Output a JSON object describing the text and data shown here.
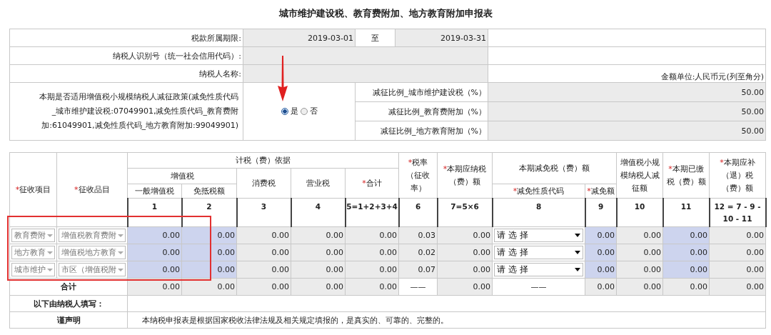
{
  "title": "城市维护建设税、教育费附加、地方教育附加申报表",
  "period": {
    "label": "税款所属期限:",
    "start": "2019-03-01",
    "to": "至",
    "end": "2019-03-31"
  },
  "taxpayer_id": {
    "label": "纳税人识别号（统一社会信用代码）:"
  },
  "taxpayer_name": {
    "label": "纳税人名称:"
  },
  "unit": "金额单位:人民币元(列至角分)",
  "policy": {
    "label": "本期是否适用增值税小规模纳税人减征政策(减免性质代码_城市维护建设税:07049901,减免性质代码_教育费附加:61049901,减免性质代码_地方教育附加:99049901)",
    "options": [
      {
        "label": "是",
        "selected": true
      },
      {
        "label": "否",
        "selected": false
      }
    ],
    "ratios": [
      {
        "label": "减征比例_城市维护建设税（%）",
        "value": "50.00"
      },
      {
        "label": "减征比例_教育费附加（%）",
        "value": "50.00"
      },
      {
        "label": "减征比例_地方教育附加（%）",
        "value": "50.00"
      }
    ]
  },
  "header": {
    "item": {
      "mark": "*",
      "label": "征收项目"
    },
    "category": {
      "mark": "*",
      "label": "征收品目"
    },
    "basis": "计税（费）依据",
    "vat": "增值税",
    "vat_general": "一般增值税",
    "vat_exempt": "免抵税额",
    "consumption": "消费税",
    "business": "营业税",
    "total": {
      "mark": "*",
      "label": "合计"
    },
    "rate": {
      "mark": "*",
      "label": "税率（征收率）"
    },
    "payable": {
      "mark": "*",
      "label": "本期应纳税（费）额"
    },
    "relief": "本期减免税（费）额",
    "relief_code": {
      "mark": "*",
      "label": "减免性质代码"
    },
    "relief_amount": {
      "mark": "*",
      "label": "减免额"
    },
    "small_scale": "增值税小规模纳税人减征额",
    "paid": {
      "mark": "*",
      "label": "本期已缴税（费）额"
    },
    "due": {
      "mark": "*",
      "label": "本期应补（退）税（费）额"
    }
  },
  "columns": [
    {
      "number": "1",
      "kind": "input"
    },
    {
      "number": "2",
      "kind": "input"
    },
    {
      "number": "3",
      "kind": "calc"
    },
    {
      "number": "4",
      "kind": "calc"
    },
    {
      "number": "5=1+2+3+4",
      "kind": "calc"
    },
    {
      "number": "6",
      "kind": "calc"
    },
    {
      "number": "7=5×6",
      "kind": "calc"
    },
    {
      "number": "8",
      "kind": "select"
    },
    {
      "number": "9",
      "kind": "input"
    },
    {
      "number": "10",
      "kind": "calc"
    },
    {
      "number": "11",
      "kind": "input"
    },
    {
      "number": "12 = 7 - 9 - 10 - 11",
      "kind": "calc"
    }
  ],
  "rows": [
    {
      "item": "教育费附",
      "category": "增值税教育费附",
      "cells": [
        "0.00",
        "0.00",
        "0.00",
        "0.00",
        "0.00",
        "0.03",
        "0.00",
        "请 选 择",
        "0.00",
        "0.00",
        "0.00",
        "0.00"
      ]
    },
    {
      "item": "地方教育",
      "category": "增值税地方教育",
      "cells": [
        "0.00",
        "0.00",
        "0.00",
        "0.00",
        "0.00",
        "0.02",
        "0.00",
        "请 选 择",
        "0.00",
        "0.00",
        "0.00",
        "0.00"
      ]
    },
    {
      "item": "城市维护",
      "category": "市区（增值税附",
      "cells": [
        "0.00",
        "0.00",
        "0.00",
        "0.00",
        "0.00",
        "0.07",
        "0.00",
        "请 选 择",
        "0.00",
        "0.00",
        "0.00",
        "0.00"
      ]
    }
  ],
  "total": {
    "label": "合计",
    "cells": [
      {
        "text": "0.00",
        "kind": "calc"
      },
      {
        "text": "0.00",
        "kind": "calc"
      },
      {
        "text": "0.00",
        "kind": "calc"
      },
      {
        "text": "0.00",
        "kind": "calc"
      },
      {
        "text": "0.00",
        "kind": "calc"
      },
      {
        "text": "——",
        "kind": "dash"
      },
      {
        "text": "0.00",
        "kind": "calc"
      },
      {
        "text": "——",
        "kind": "dash"
      },
      {
        "text": "0.00",
        "kind": "calc"
      },
      {
        "text": "0.00",
        "kind": "calc"
      },
      {
        "text": "0.00",
        "kind": "calc"
      },
      {
        "text": "0.00",
        "kind": "calc"
      }
    ]
  },
  "fill_note": "以下由纳税人填写：",
  "declaration": {
    "label": "谨声明",
    "text": "本纳税申报表是根据国家税收法律法规及相关规定填报的，是真实的、可靠的、完整的。"
  }
}
